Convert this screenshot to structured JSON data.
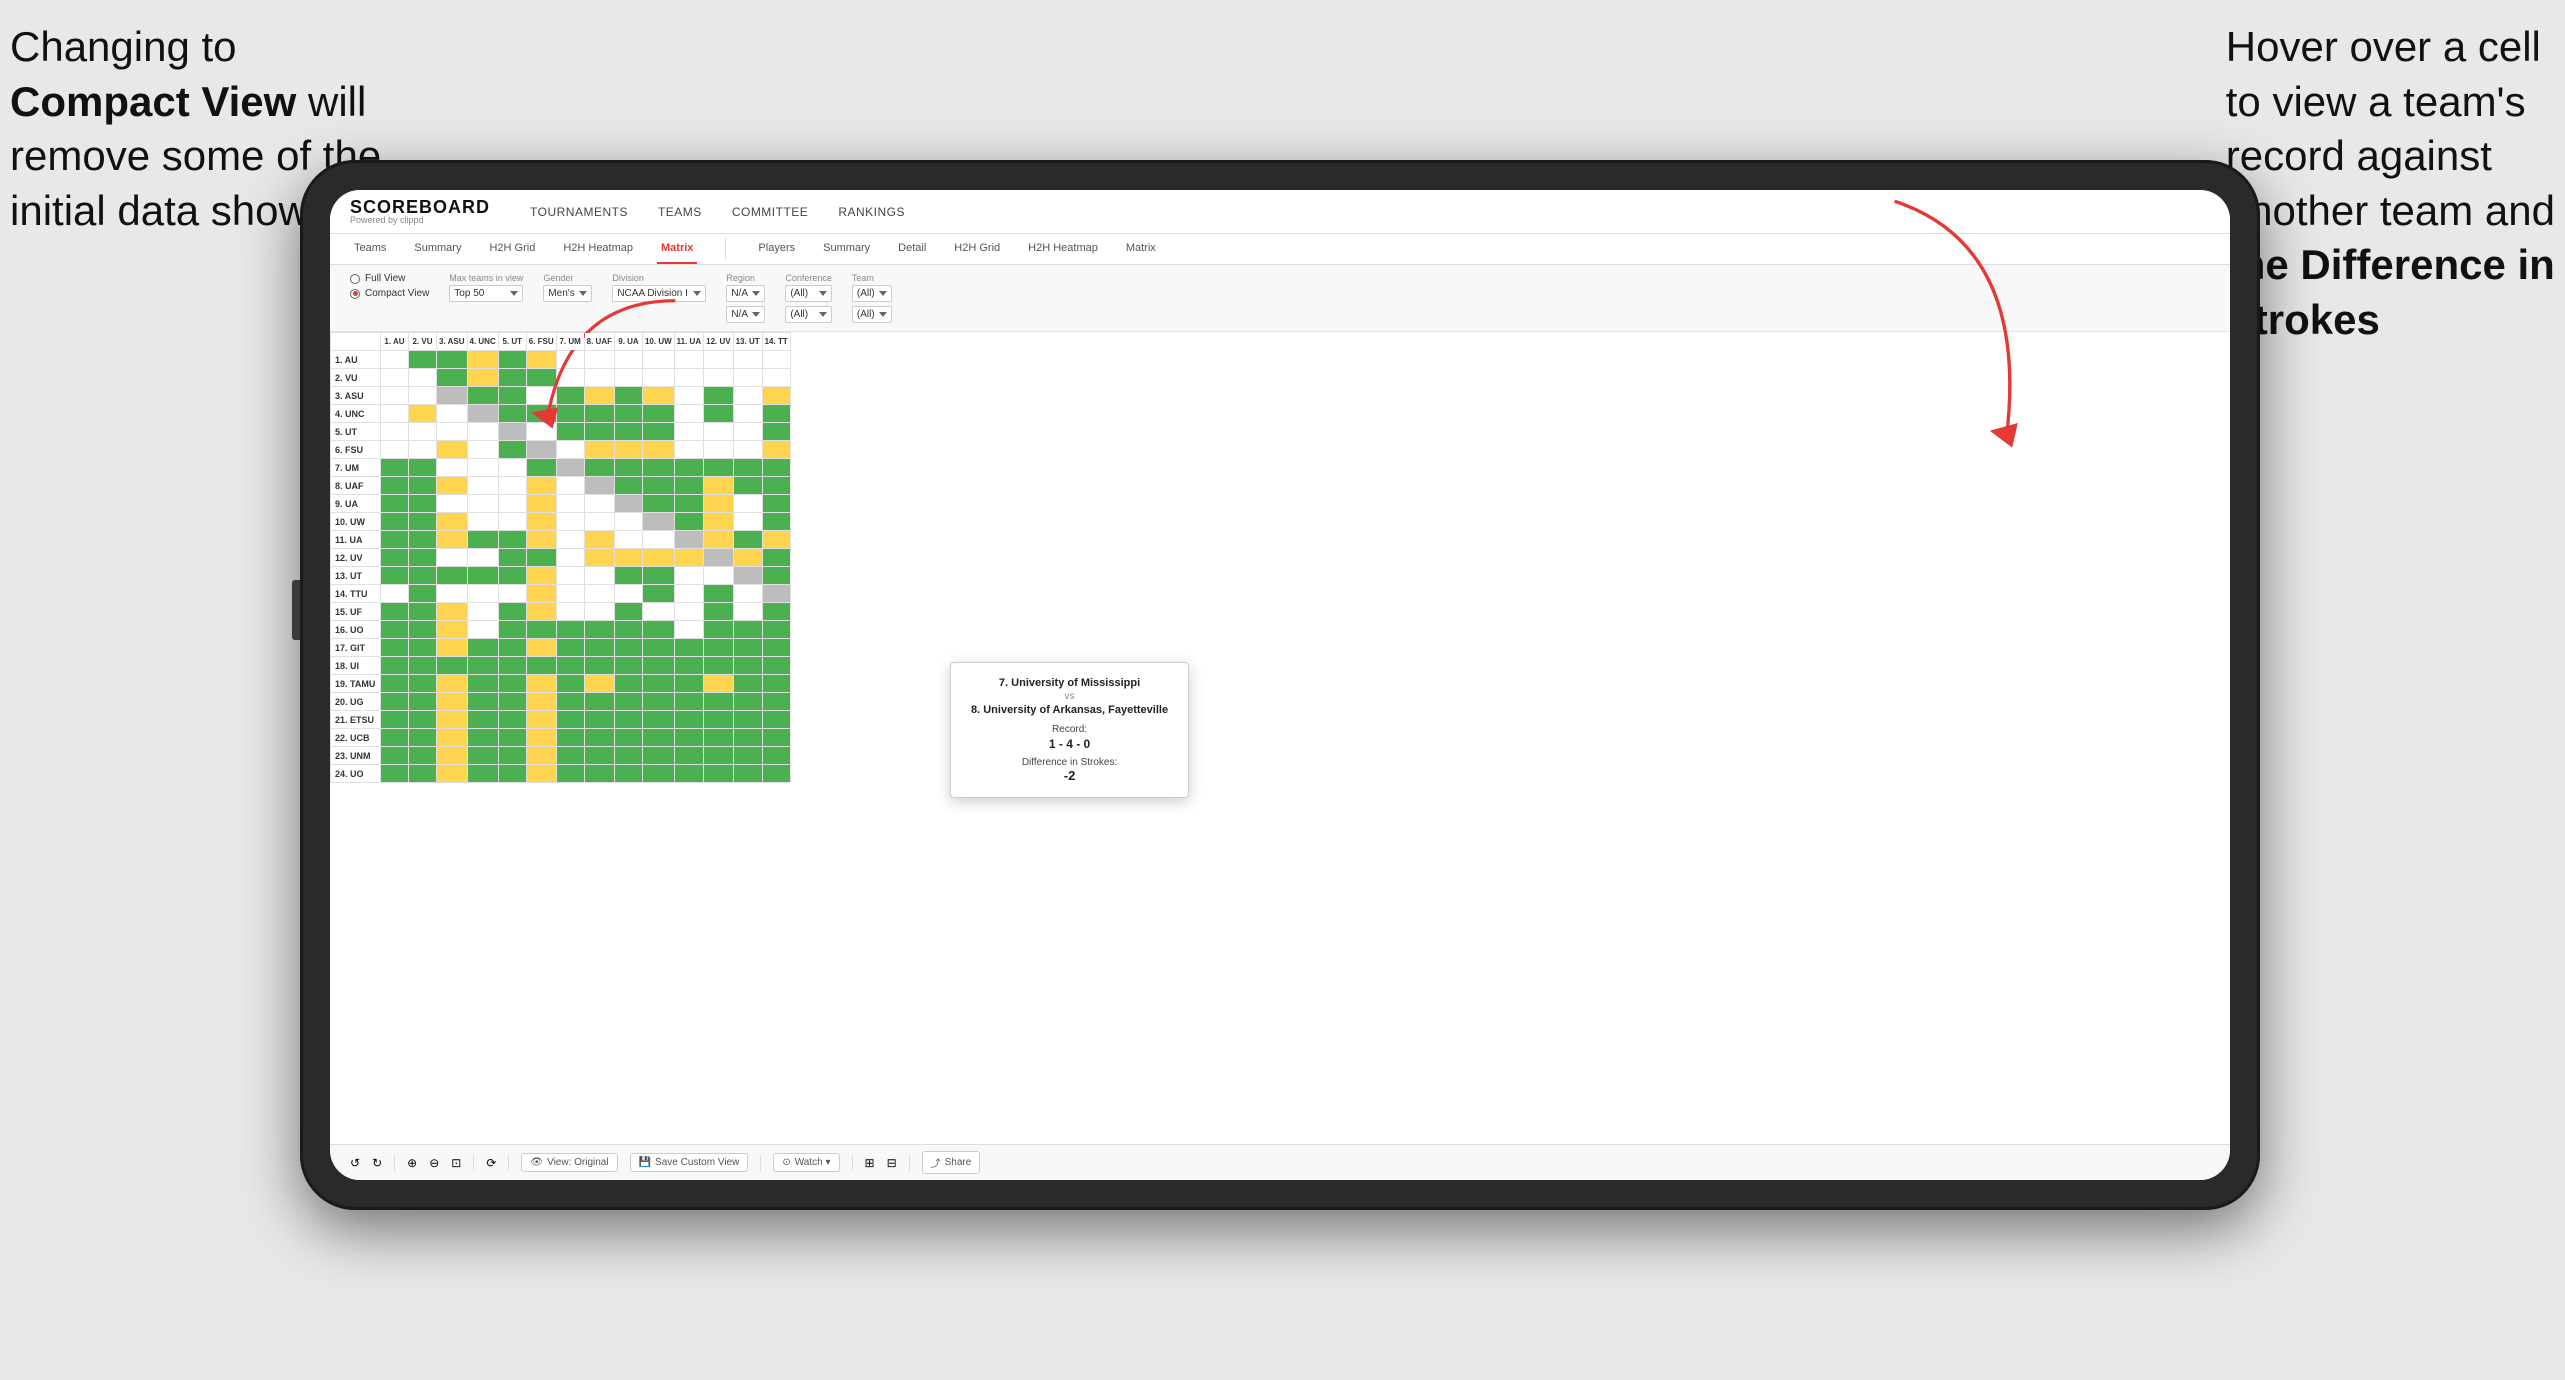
{
  "annotations": {
    "left": {
      "line1": "Changing to",
      "line2_bold": "Compact View",
      "line2_rest": " will",
      "line3": "remove some of the",
      "line4": "initial data shown"
    },
    "right": {
      "line1": "Hover over a cell",
      "line2": "to view a team's",
      "line3": "record against",
      "line4": "another team and",
      "line5_bold": "the Difference in",
      "line6_bold": "Strokes"
    }
  },
  "app": {
    "logo": "SCOREBOARD",
    "logo_sub": "Powered by clippd",
    "nav": [
      "TOURNAMENTS",
      "TEAMS",
      "COMMITTEE",
      "RANKINGS"
    ]
  },
  "sub_nav": {
    "group1": [
      "Teams",
      "Summary",
      "H2H Grid",
      "H2H Heatmap",
      "Matrix"
    ],
    "group2": [
      "Players",
      "Summary",
      "Detail",
      "H2H Grid",
      "H2H Heatmap",
      "Matrix"
    ],
    "active": "Matrix"
  },
  "controls": {
    "view_options": [
      "Full View",
      "Compact View"
    ],
    "selected_view": "Compact View",
    "filters": [
      {
        "label": "Max teams in view",
        "value": "Top 50"
      },
      {
        "label": "Gender",
        "value": "Men's"
      },
      {
        "label": "Division",
        "value": "NCAA Division I"
      },
      {
        "label": "Region",
        "value": "N/A"
      },
      {
        "label": "Conference",
        "value": "(All)"
      },
      {
        "label": "Team",
        "value": "(All)"
      }
    ]
  },
  "tooltip": {
    "team1": "7. University of Mississippi",
    "vs": "vs",
    "team2": "8. University of Arkansas, Fayetteville",
    "record_label": "Record:",
    "record_value": "1 - 4 - 0",
    "strokes_label": "Difference in Strokes:",
    "strokes_value": "-2"
  },
  "col_headers": [
    "1. AU",
    "2. VU",
    "3. ASU",
    "4. UNC",
    "5. UT",
    "6. FSU",
    "7. UM",
    "8. UAF",
    "9. UA",
    "10. UW",
    "11. UA",
    "12. UV",
    "13. UT",
    "14. TT"
  ],
  "row_headers": [
    "1. AU",
    "2. VU",
    "3. ASU",
    "4. UNC",
    "5. UT",
    "6. FSU",
    "7. UM",
    "8. UAF",
    "9. UA",
    "10. UW",
    "11. UA",
    "12. UV",
    "13. UT",
    "14. TTU",
    "15. UF",
    "16. UO",
    "17. GIT",
    "18. UI",
    "19. TAMU",
    "20. UG",
    "21. ETSU",
    "22. UCB",
    "23. UNM",
    "24. UO"
  ],
  "toolbar": {
    "buttons": [
      "View: Original",
      "Save Custom View",
      "Watch",
      "Share"
    ]
  }
}
